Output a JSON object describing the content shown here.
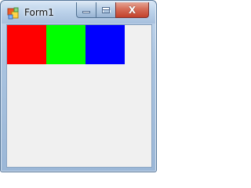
{
  "window": {
    "title": "Form1",
    "icon": "windows-form-icon"
  },
  "caption_buttons": [
    {
      "name": "minimize-button",
      "icon": "minimize-icon"
    },
    {
      "name": "maximize-button",
      "icon": "maximize-icon"
    },
    {
      "name": "close-button",
      "icon": "close-icon",
      "label": "X"
    }
  ],
  "content": {
    "panels": [
      {
        "name": "red-panel",
        "color": "#ff0000"
      },
      {
        "name": "green-panel",
        "color": "#00ff00"
      },
      {
        "name": "blue-panel",
        "color": "#0000ff"
      }
    ]
  }
}
